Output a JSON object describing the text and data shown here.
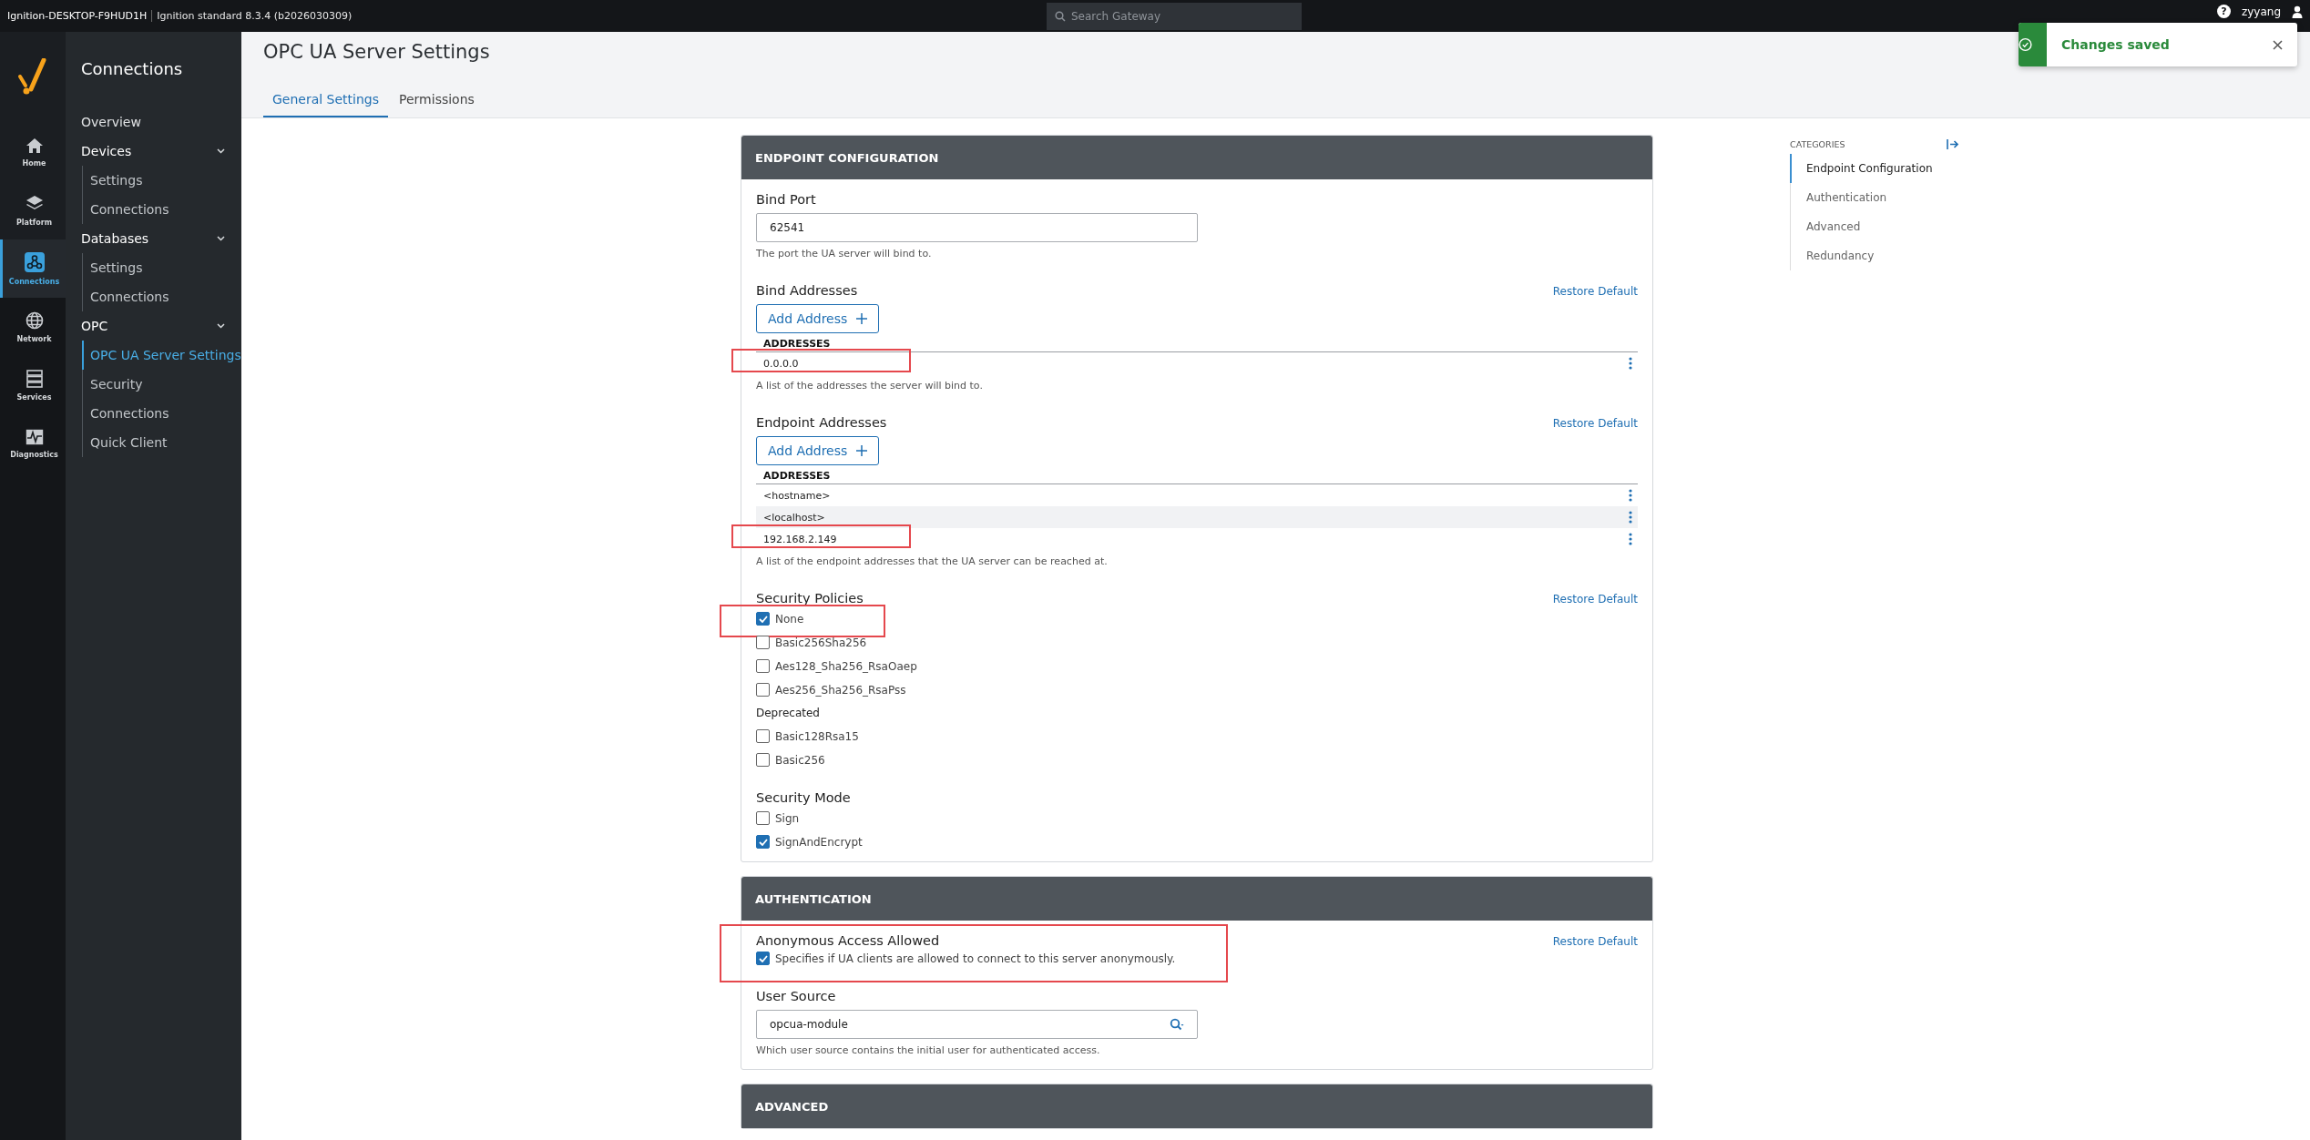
{
  "top_bar": {
    "host": "Ignition-DESKTOP-F9HUD1H",
    "version": "Ignition standard 8.3.4 (b2026030309)",
    "search": {
      "placeholder": "Search Gateway"
    },
    "help": "?",
    "user": "zyyang"
  },
  "rail": [
    {
      "label": "Home",
      "selected": false
    },
    {
      "label": "Platform",
      "selected": false
    },
    {
      "label": "Connections",
      "selected": true
    },
    {
      "label": "Network",
      "selected": false
    },
    {
      "label": "Services",
      "selected": false
    },
    {
      "label": "Diagnostics",
      "selected": false
    }
  ],
  "nav": {
    "title": "Connections",
    "items": [
      {
        "label": "Overview",
        "selected": false
      },
      {
        "label": "Devices",
        "expanded": true,
        "children": [
          {
            "label": "Settings",
            "selected": false
          },
          {
            "label": "Connections",
            "selected": false
          }
        ]
      },
      {
        "label": "Databases",
        "expanded": true,
        "children": [
          {
            "label": "Settings",
            "selected": false
          },
          {
            "label": "Connections",
            "selected": false
          }
        ]
      },
      {
        "label": "OPC",
        "expanded": true,
        "children": [
          {
            "label": "OPC UA Server Settings",
            "selected": true
          },
          {
            "label": "Security",
            "selected": false
          },
          {
            "label": "Connections",
            "selected": false
          },
          {
            "label": "Quick Client",
            "selected": false
          }
        ]
      }
    ]
  },
  "page": {
    "title": "OPC UA Server Settings",
    "tabs": [
      {
        "label": "General Settings",
        "selected": true
      },
      {
        "label": "Permissions",
        "selected": false
      }
    ]
  },
  "toast": {
    "message": "Changes saved"
  },
  "sections": [
    {
      "title": "ENDPOINT CONFIGURATION",
      "fields": [
        {
          "kind": "text",
          "label": "Bind Port",
          "value": "62541",
          "description": "The port the UA server will bind to."
        },
        {
          "kind": "list",
          "label": "Bind Addresses",
          "restore": "Restore Default",
          "button": "Add Address",
          "column": "ADDRESSES",
          "rows": [
            {
              "value": "0.0.0.0",
              "highlighted": true
            }
          ],
          "description": "A list of the addresses the server will bind to."
        },
        {
          "kind": "list",
          "label": "Endpoint Addresses",
          "restore": "Restore Default",
          "button": "Add Address",
          "column": "ADDRESSES",
          "rows": [
            {
              "value": "<hostname>",
              "highlighted": false
            },
            {
              "value": "<localhost>",
              "highlighted": false
            },
            {
              "value": "192.168.2.149",
              "highlighted": true
            }
          ],
          "description": "A list of the endpoint addresses that the UA server can be reached at."
        },
        {
          "kind": "checks",
          "label": "Security Policies",
          "restore": "Restore Default",
          "options": [
            {
              "label": "None",
              "checked": true,
              "highlighted": true
            },
            {
              "label": "Basic256Sha256",
              "checked": false,
              "highlighted": false
            },
            {
              "label": "Aes128_Sha256_RsaOaep",
              "checked": false,
              "highlighted": false
            },
            {
              "label": "Aes256_Sha256_RsaPss",
              "checked": false,
              "highlighted": false
            }
          ],
          "subheading": "Deprecated",
          "more_options": [
            {
              "label": "Basic128Rsa15",
              "checked": false,
              "highlighted": false
            },
            {
              "label": "Basic256",
              "checked": false,
              "highlighted": false
            }
          ]
        },
        {
          "kind": "checks",
          "label": "Security Mode",
          "options": [
            {
              "label": "Sign",
              "checked": false,
              "highlighted": false
            },
            {
              "label": "SignAndEncrypt",
              "checked": true,
              "highlighted": false
            }
          ]
        }
      ]
    },
    {
      "title": "AUTHENTICATION",
      "fields": [
        {
          "kind": "toggle",
          "label": "Anonymous Access Allowed",
          "restore": "Restore Default",
          "checked": true,
          "description": "Specifies if UA clients are allowed to connect to this server anonymously.",
          "highlighted": true
        },
        {
          "kind": "lookup",
          "label": "User Source",
          "value": "opcua-module",
          "description": "Which user source contains the initial user for authenticated access."
        }
      ]
    },
    {
      "title": "ADVANCED"
    }
  ],
  "categories": {
    "title": "CATEGORIES",
    "items": [
      {
        "label": "Endpoint Configuration",
        "selected": true
      },
      {
        "label": "Authentication",
        "selected": false
      },
      {
        "label": "Advanced",
        "selected": false
      },
      {
        "label": "Redundancy",
        "selected": false
      }
    ]
  }
}
